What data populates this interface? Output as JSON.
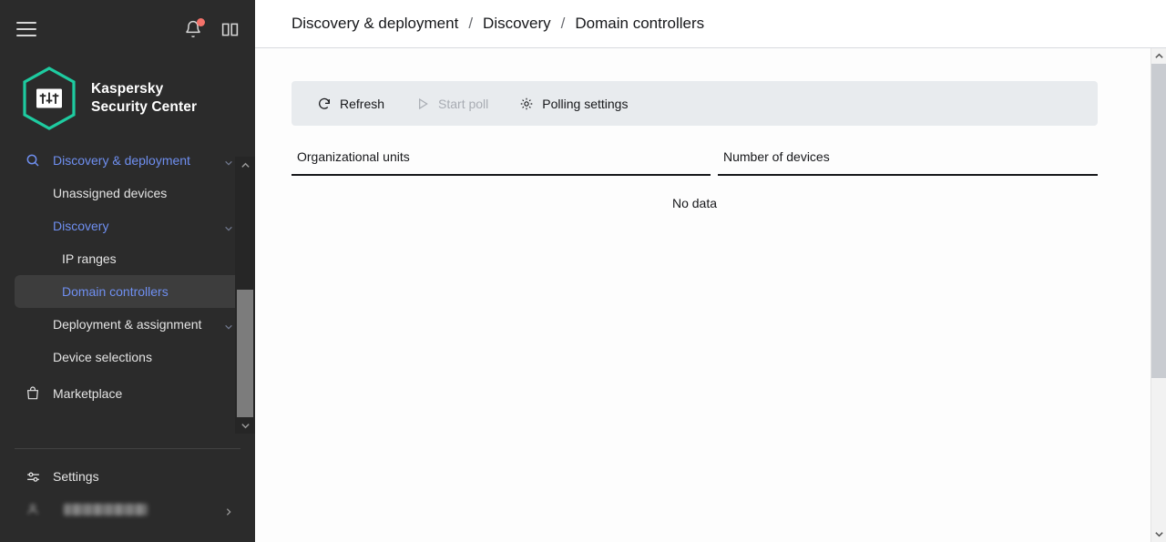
{
  "sidebar": {
    "menu_icon": "hamburger-icon",
    "header_icons": [
      {
        "name": "notifications-bell-icon",
        "has_badge": true
      },
      {
        "name": "documentation-book-icon",
        "has_badge": false
      }
    ],
    "logo": {
      "line1": "Kaspersky",
      "line2": "Security Center",
      "accent": "#1ecba0"
    },
    "nav": [
      {
        "label": "Discovery & deployment",
        "icon": "search-icon",
        "level": 0,
        "blue": true,
        "chevron": true,
        "active": false
      },
      {
        "label": "Unassigned devices",
        "icon": "",
        "level": 1,
        "blue": false,
        "chevron": false,
        "active": false
      },
      {
        "label": "Discovery",
        "icon": "",
        "level": 1,
        "blue": true,
        "chevron": true,
        "active": false
      },
      {
        "label": "IP ranges",
        "icon": "",
        "level": 2,
        "blue": false,
        "chevron": false,
        "active": false
      },
      {
        "label": "Domain controllers",
        "icon": "",
        "level": 2,
        "blue": false,
        "chevron": false,
        "active": true
      },
      {
        "label": "Deployment & assignment",
        "icon": "",
        "level": 1,
        "blue": false,
        "chevron": true,
        "active": false
      },
      {
        "label": "Device selections",
        "icon": "",
        "level": 1,
        "blue": false,
        "chevron": false,
        "active": false
      },
      {
        "label": "Marketplace",
        "icon": "shopping-bag-icon",
        "level": 0,
        "blue": false,
        "chevron": false,
        "active": false
      }
    ],
    "settings": {
      "label": "Settings",
      "icon": "sliders-icon"
    },
    "user": {
      "label": "",
      "icon": "user-avatar-icon",
      "redacted": true
    },
    "active_color": "#6f8ff0",
    "active_bg": "#3d3d3d"
  },
  "breadcrumb": {
    "items": [
      "Discovery & deployment",
      "Discovery",
      "Domain controllers"
    ],
    "separator": "/"
  },
  "toolbar": {
    "refresh_label": "Refresh",
    "refresh_icon": "refresh-icon",
    "start_poll_label": "Start poll",
    "start_poll_icon": "play-icon",
    "start_poll_disabled": true,
    "polling_settings_label": "Polling settings",
    "polling_settings_icon": "gear-icon",
    "background": "#e8ebee"
  },
  "table": {
    "columns": [
      "Organizational units",
      "Number of devices"
    ],
    "rows": [],
    "empty_message": "No data"
  },
  "scrollbars": {
    "sidebar": {
      "up_icon": "chevron-up-icon",
      "down_icon": "chevron-down-icon"
    },
    "page": {
      "up_icon": "chevron-up-icon",
      "down_icon": "chevron-down-icon"
    }
  }
}
